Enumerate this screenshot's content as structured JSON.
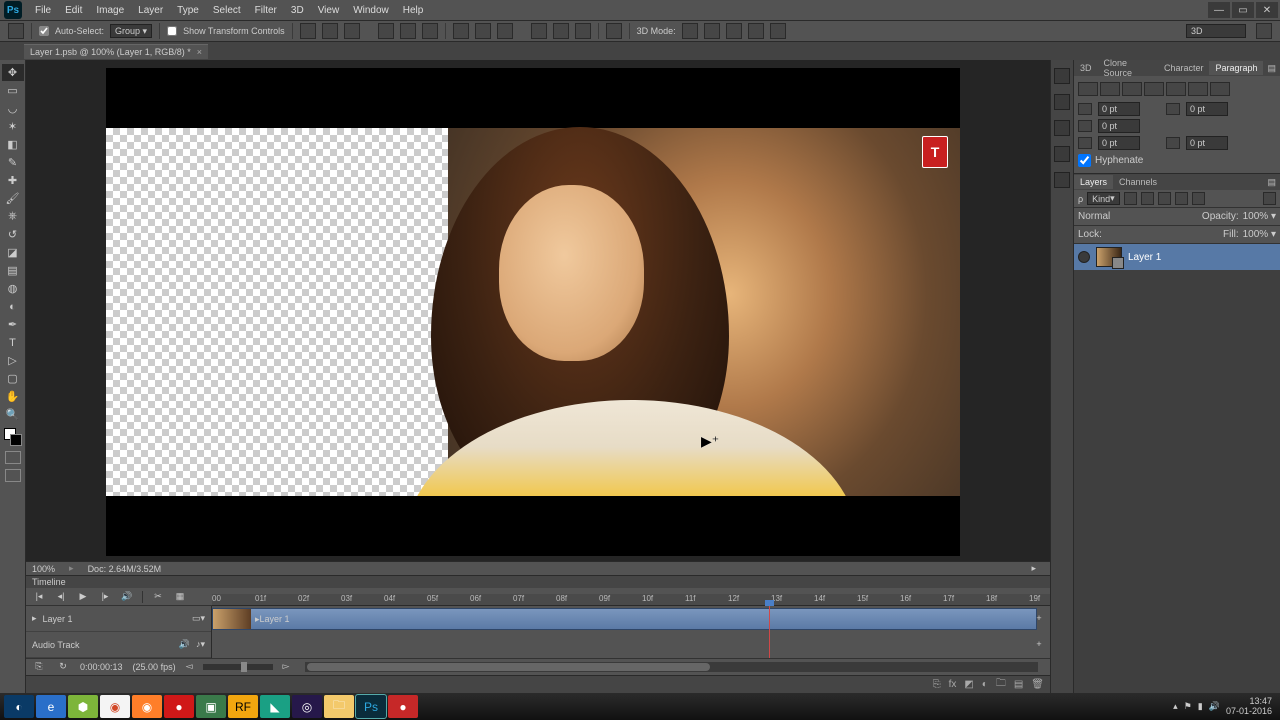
{
  "menubar": {
    "items": [
      "File",
      "Edit",
      "Image",
      "Layer",
      "Type",
      "Select",
      "Filter",
      "3D",
      "View",
      "Window",
      "Help"
    ]
  },
  "optionsbar": {
    "auto_select": "Auto-Select:",
    "group": "Group",
    "show_transform": "Show Transform Controls",
    "mode_3d_label": "3D Mode:",
    "right_3d": "3D"
  },
  "document": {
    "tab_title": "Layer 1.psb @ 100% (Layer 1, RGB/8) *"
  },
  "status": {
    "zoom": "100%",
    "doc": "Doc: 2.64M/3.52M"
  },
  "badge": {
    "letter": "T"
  },
  "timeline": {
    "tab": "Timeline",
    "ticks": [
      "00",
      "01f",
      "02f",
      "03f",
      "04f",
      "05f",
      "06f",
      "07f",
      "08f",
      "09f",
      "10f",
      "11f",
      "12f",
      "13f",
      "14f",
      "15f",
      "16f",
      "17f",
      "18f",
      "19f"
    ],
    "track_layer": "Layer 1",
    "clip_label": "Layer 1",
    "audio_track": "Audio Track",
    "timecode": "0:00:00:13",
    "fps": "(25.00 fps)"
  },
  "paragraph": {
    "tabs": [
      "3D",
      "Clone Source",
      "Character",
      "Paragraph"
    ],
    "indent_left": "0 pt",
    "indent_right": "0 pt",
    "first_line": "0 pt",
    "space_before": "0 pt",
    "space_after": "0 pt",
    "hyphenate": "Hyphenate"
  },
  "layers": {
    "tabs": [
      "Layers",
      "Channels"
    ],
    "kind": "Kind",
    "blend": "Normal",
    "opacity_label": "Opacity:",
    "opacity_val": "100%",
    "lock_label": "Lock:",
    "fill_label": "Fill:",
    "fill_val": "100%",
    "layer1": "Layer 1"
  },
  "taskbar": {
    "time": "13:47",
    "date": "07-01-2016"
  }
}
